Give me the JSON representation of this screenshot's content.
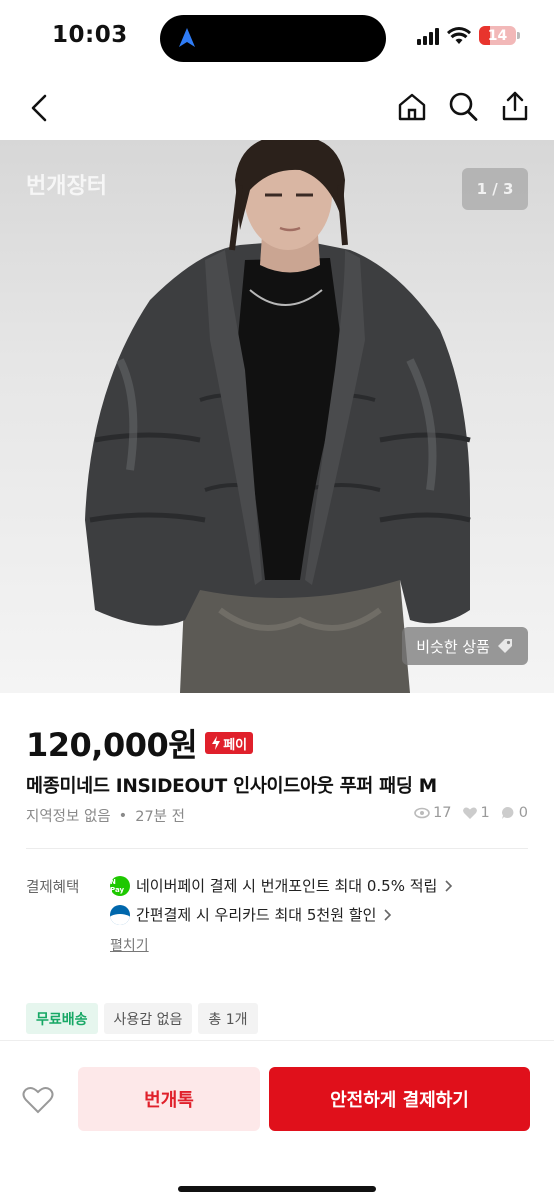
{
  "status": {
    "time": "10:03",
    "battery": "14"
  },
  "nav": {
    "icons": [
      "back-arrow-icon",
      "home-icon",
      "search-icon",
      "share-icon"
    ]
  },
  "photo": {
    "watermark": "번개장터",
    "counter": "1 / 3",
    "similar_label": "비슷한 상품"
  },
  "product": {
    "price": "120,000원",
    "pay_badge": "페이",
    "title": "메종미네드 INSIDEOUT 인사이드아웃 푸퍼 패딩 M",
    "location": "지역정보 없음",
    "dot": "•",
    "time_ago": "27분 전",
    "views": "17",
    "likes": "1",
    "chats": "0"
  },
  "benefits": {
    "label": "결제혜택",
    "items": [
      {
        "icon": "npay-icon",
        "icon_text": "N Pay",
        "text": "네이버페이 결제 시 번개포인트 최대 0.5% 적립"
      },
      {
        "icon": "woori-card-icon",
        "text": "간편결제 시 우리카드 최대 5천원 할인"
      }
    ],
    "expand_label": "펼치기"
  },
  "tags": [
    "무료배송",
    "사용감 없음",
    "총 1개"
  ],
  "bottom": {
    "chat_label": "번개톡",
    "pay_label": "안전하게 결제하기"
  },
  "colors": {
    "accent": "#e0101b",
    "accent_light": "#fde8e9",
    "free_ship": "#17a865"
  }
}
